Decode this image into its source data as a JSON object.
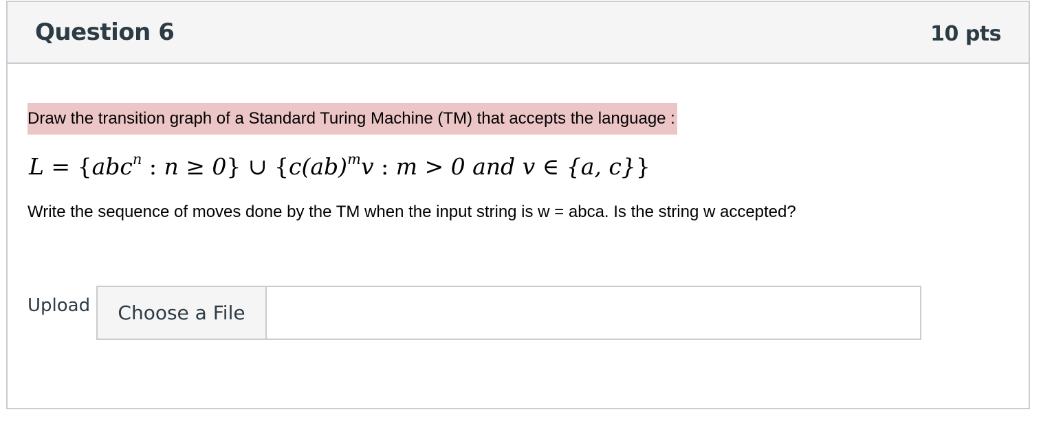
{
  "question": {
    "title": "Question 6",
    "points": "10 pts"
  },
  "body": {
    "highlight_text": "Draw the transition graph of a Standard Turing Machine (TM) that accepts the language :",
    "formula": {
      "lhs": "L",
      "eq": " = {",
      "set1_var": "abc",
      "set1_exp": "n",
      "set1_cond_sep": " : ",
      "set1_cond": "n ≥ 0",
      "union": "} ∪ {",
      "set2_a": "c(ab)",
      "set2_exp": "m",
      "set2_b": "v",
      "set2_cond_sep": " : ",
      "set2_cond": "m > 0 and v ∈ {a, c}",
      "close": "}"
    },
    "prompt": "Write the sequence of moves done by the TM when the input string is w = abca. Is the string w accepted?"
  },
  "upload": {
    "label": "Upload",
    "button_label": "Choose a File"
  }
}
